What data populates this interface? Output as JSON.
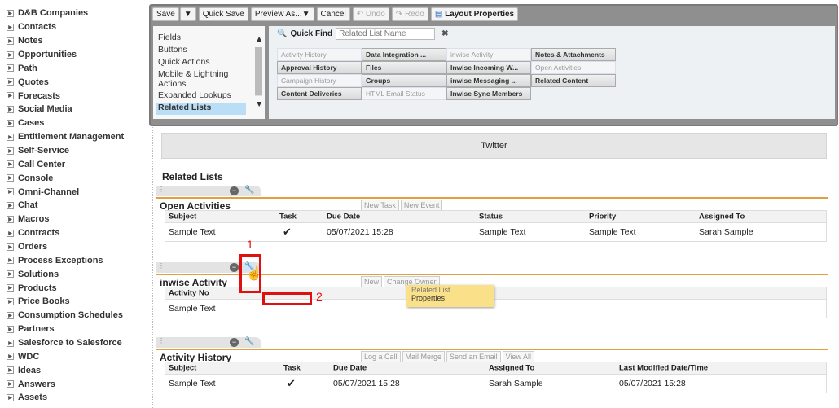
{
  "sidebar": {
    "items": [
      "D&B Companies",
      "Contacts",
      "Notes",
      "Opportunities",
      "Path",
      "Quotes",
      "Forecasts",
      "Social Media",
      "Cases",
      "Entitlement Management",
      "Self-Service",
      "Call Center",
      "Console",
      "Omni-Channel",
      "Chat",
      "Macros",
      "Contracts",
      "Orders",
      "Process Exceptions",
      "Solutions",
      "Products",
      "Price Books",
      "Consumption Schedules",
      "Partners",
      "Salesforce to Salesforce",
      "WDC",
      "Ideas",
      "Answers",
      "Assets"
    ]
  },
  "toolbar": {
    "save": "Save",
    "save_menu": "▼",
    "quick_save": "Quick Save",
    "preview_as": "Preview As...▼",
    "cancel": "Cancel",
    "undo": "Undo",
    "redo": "Redo",
    "layout_properties": "Layout Properties"
  },
  "palette": {
    "categories": [
      "Fields",
      "Buttons",
      "Quick Actions",
      "Mobile & Lightning Actions",
      "Expanded Lookups",
      "Related Lists"
    ],
    "quick_find_label": "Quick Find",
    "quick_find_placeholder": "Related List Name",
    "chips": [
      [
        "Activity History",
        "Data Integration ...",
        "inwise Activity",
        "Notes & Attachments"
      ],
      [
        "Approval History",
        "Files",
        "Inwise Incoming W...",
        "Open Activities"
      ],
      [
        "Campaign History",
        "Groups",
        "inwise Messaging ...",
        "Related Content"
      ],
      [
        "Content Deliveries",
        "HTML Email Status",
        "Inwise Sync Members",
        ""
      ]
    ],
    "used": [
      [
        true,
        false,
        true,
        false
      ],
      [
        false,
        false,
        false,
        true
      ],
      [
        true,
        false,
        false,
        false
      ],
      [
        false,
        true,
        false,
        false
      ]
    ]
  },
  "twitter": "Twitter",
  "related_lists_heading": "Related Lists",
  "open_activities": {
    "title": "Open Activities",
    "buttons": [
      "New Task",
      "New Event"
    ],
    "columns": [
      "Subject",
      "Task",
      "Due Date",
      "Status",
      "Priority",
      "Assigned To"
    ],
    "row": [
      "Sample Text",
      "✔",
      "05/07/2021 15:28",
      "Sample Text",
      "Sample Text",
      "Sarah Sample"
    ]
  },
  "inwise_activity": {
    "title": "inwise Activity",
    "buttons": [
      "New",
      "Change Owner"
    ],
    "columns": [
      "Activity No"
    ],
    "row": [
      "Sample Text"
    ]
  },
  "popup": {
    "item1": "Related List",
    "item2": "Properties"
  },
  "annotations": {
    "step1": "1",
    "step2": "2"
  },
  "activity_history": {
    "title": "Activity History",
    "buttons": [
      "Log a Call",
      "Mail Merge",
      "Send an Email",
      "View All"
    ],
    "columns": [
      "Subject",
      "Task",
      "Due Date",
      "Assigned To",
      "Last Modified Date/Time"
    ],
    "row": [
      "Sample Text",
      "✔",
      "05/07/2021 15:28",
      "Sarah Sample",
      "05/07/2021 15:28"
    ]
  }
}
